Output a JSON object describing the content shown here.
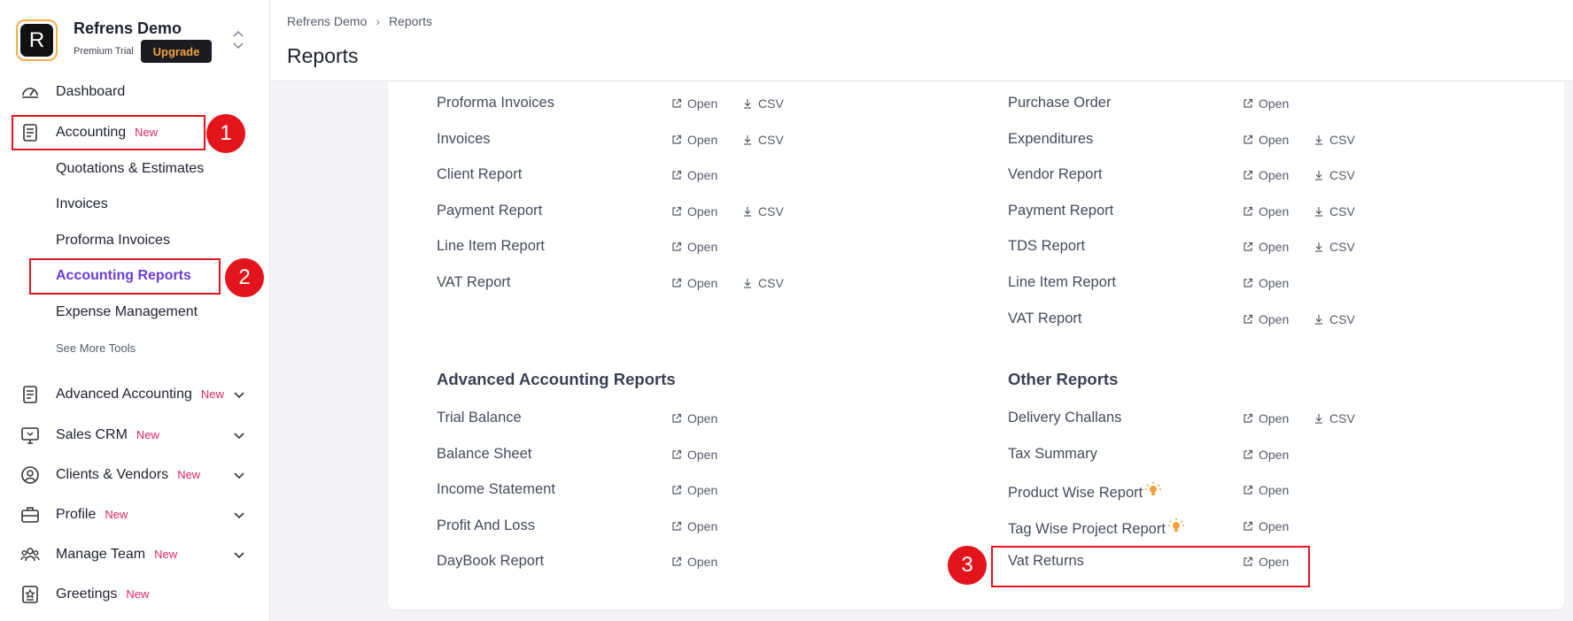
{
  "org": {
    "logo_letter": "R",
    "name": "Refrens Demo",
    "plan": "Premium Trial",
    "upgrade_label": "Upgrade"
  },
  "nav": {
    "dashboard": "Dashboard",
    "accounting": "Accounting",
    "accounting_badge": "New",
    "accounting_sub": [
      "Quotations & Estimates",
      "Invoices",
      "Proforma Invoices",
      "Accounting Reports",
      "Expense Management"
    ],
    "see_more": "See More Tools",
    "advanced_accounting": "Advanced Accounting",
    "advanced_accounting_badge": "New",
    "sales_crm": "Sales CRM",
    "sales_crm_badge": "New",
    "clients_vendors": "Clients & Vendors",
    "clients_vendors_badge": "New",
    "profile": "Profile",
    "profile_badge": "New",
    "manage_team": "Manage Team",
    "manage_team_badge": "New",
    "greetings": "Greetings",
    "greetings_badge": "New"
  },
  "header": {
    "breadcrumb": [
      "Refrens Demo",
      "Reports"
    ],
    "title": "Reports"
  },
  "labels": {
    "open": "Open",
    "csv": "CSV"
  },
  "annotations": [
    "1",
    "2",
    "3"
  ],
  "reports": {
    "sales": [
      "Proforma Invoices",
      "Invoices",
      "Client Report",
      "Payment Report",
      "Line Item Report",
      "VAT Report"
    ],
    "purchase": [
      "Purchase Order",
      "Expenditures",
      "Vendor Report",
      "Payment Report",
      "TDS Report",
      "Line Item Report",
      "VAT Report"
    ],
    "advanced_title": "Advanced Accounting Reports",
    "advanced": [
      "Trial Balance",
      "Balance Sheet",
      "Income Statement",
      "Profit And Loss",
      "DayBook Report"
    ],
    "other_title": "Other Reports",
    "other": [
      "Delivery Challans",
      "Tax Summary",
      "Product Wise Report",
      "Tag Wise Project Report",
      "Vat Returns"
    ]
  },
  "colors": {
    "accent": "#6b3cd6",
    "new_badge": "#e0245e",
    "annotation": "#e3141b",
    "upgrade_text": "#f3a13a"
  }
}
